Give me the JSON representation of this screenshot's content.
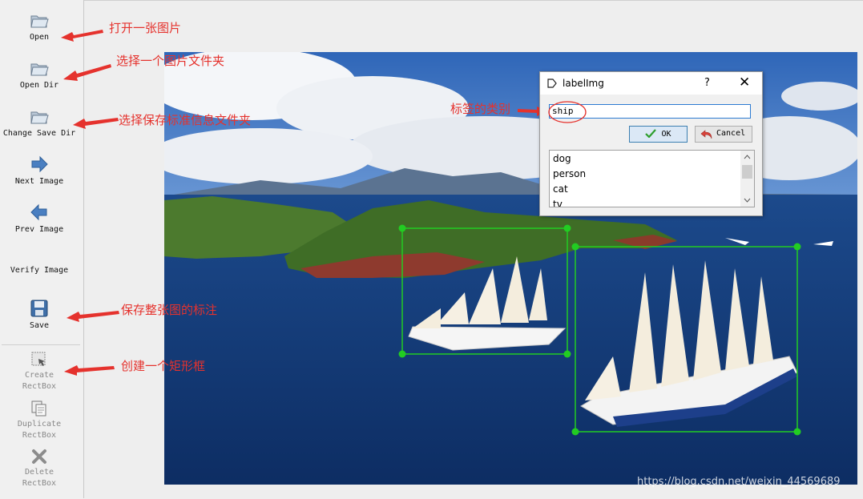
{
  "toolbar": {
    "open": "Open",
    "open_dir": "Open Dir",
    "change_save_dir": "Change Save Dir",
    "next_image": "Next Image",
    "prev_image": "Prev Image",
    "verify_image": "Verify Image",
    "save": "Save",
    "create_rectbox_1": "Create",
    "create_rectbox_2": "RectBox",
    "duplicate_rectbox_1": "Duplicate",
    "duplicate_rectbox_2": "RectBox",
    "delete_rectbox_1": "Delete",
    "delete_rectbox_2": "RectBox"
  },
  "annotations": {
    "open": "打开一张图片",
    "open_dir": "选择一个图片文件夹",
    "change_save_dir": "选择保存标准信息文件夹",
    "save": "保存整张图的标注",
    "create": "创建一个矩形框",
    "label_class": "标签的类别"
  },
  "dialog": {
    "title": "labelImg",
    "help": "?",
    "close": "✕",
    "input_value": "ship",
    "ok_label": "OK",
    "cancel_label": "Cancel",
    "labels": [
      "dog",
      "person",
      "cat",
      "tv"
    ]
  },
  "watermark": "https://blog.csdn.net/weixin_44569689",
  "colors": {
    "annotation": "#e5322d",
    "bbox": "#22cc22",
    "accent": "#2b7ad1"
  }
}
